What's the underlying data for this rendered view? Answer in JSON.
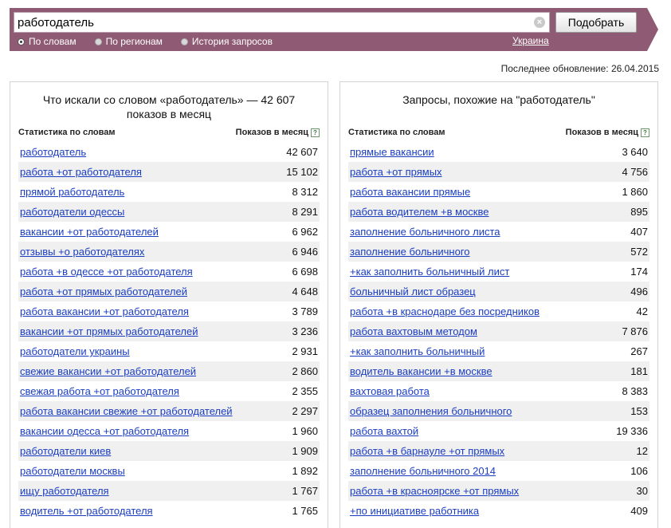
{
  "search": {
    "query": "работодатель",
    "submit_label": "Подобрать",
    "clear_glyph": "×"
  },
  "modes": [
    {
      "label": "По словам",
      "selected": true
    },
    {
      "label": "По регионам",
      "selected": false
    },
    {
      "label": "История запросов",
      "selected": false
    }
  ],
  "region": "Украина",
  "last_update": "Последнее обновление: 26.04.2015",
  "left_panel": {
    "title": "Что искали со словом «работодатель» — 42 607 показов в месяц",
    "col_phrase": "Статистика по словам",
    "col_count": "Показов в месяц",
    "help_glyph": "?",
    "rows": [
      {
        "phrase": "работодатель",
        "count": "42 607"
      },
      {
        "phrase": "работа +от работодателя",
        "count": "15 102"
      },
      {
        "phrase": "прямой работодатель",
        "count": "8 312"
      },
      {
        "phrase": "работодатели одессы",
        "count": "8 291"
      },
      {
        "phrase": "вакансии +от работодателей",
        "count": "6 962"
      },
      {
        "phrase": "отзывы +о работодателях",
        "count": "6 946"
      },
      {
        "phrase": "работа +в одессе +от работодателя",
        "count": "6 698"
      },
      {
        "phrase": "работа +от прямых работодателей",
        "count": "4 648"
      },
      {
        "phrase": "работа вакансии +от работодателя",
        "count": "3 789"
      },
      {
        "phrase": "вакансии +от прямых работодателей",
        "count": "3 236"
      },
      {
        "phrase": "работодатели украины",
        "count": "2 931"
      },
      {
        "phrase": "свежие вакансии +от работодателей",
        "count": "2 860"
      },
      {
        "phrase": "свежая работа +от работодателя",
        "count": "2 355"
      },
      {
        "phrase": "работа вакансии свежие +от работодателей",
        "count": "2 297"
      },
      {
        "phrase": "вакансии одесса +от работодателя",
        "count": "1 960"
      },
      {
        "phrase": "работодатели киев",
        "count": "1 909"
      },
      {
        "phrase": "работодатели москвы",
        "count": "1 892"
      },
      {
        "phrase": "ищу работодателя",
        "count": "1 767"
      },
      {
        "phrase": "водитель +от работодателя",
        "count": "1 765"
      }
    ]
  },
  "right_panel": {
    "title": "Запросы, похожие на \"работодатель\"",
    "col_phrase": "Статистика по словам",
    "col_count": "Показов в месяц",
    "help_glyph": "?",
    "rows": [
      {
        "phrase": "прямые вакансии",
        "count": "3 640"
      },
      {
        "phrase": "работа +от прямых",
        "count": "4 756"
      },
      {
        "phrase": "работа вакансии прямые",
        "count": "1 860"
      },
      {
        "phrase": "работа водителем +в москве",
        "count": "895"
      },
      {
        "phrase": "заполнение больничного листа",
        "count": "407"
      },
      {
        "phrase": "заполнение больничного",
        "count": "572"
      },
      {
        "phrase": "+как заполнить больничный лист",
        "count": "174"
      },
      {
        "phrase": "больничный лист образец",
        "count": "496"
      },
      {
        "phrase": "работа +в краснодаре без посредников",
        "count": "42"
      },
      {
        "phrase": "работа вахтовым методом",
        "count": "7 876"
      },
      {
        "phrase": "+как заполнить больничный",
        "count": "267"
      },
      {
        "phrase": "водитель вакансии +в москве",
        "count": "181"
      },
      {
        "phrase": "вахтовая работа",
        "count": "8 383"
      },
      {
        "phrase": "образец заполнения больничного",
        "count": "153"
      },
      {
        "phrase": "работа вахтой",
        "count": "19 336"
      },
      {
        "phrase": "работа +в барнауле +от прямых",
        "count": "12"
      },
      {
        "phrase": "заполнение больничного 2014",
        "count": "106"
      },
      {
        "phrase": "работа +в красноярске +от прямых",
        "count": "30"
      },
      {
        "phrase": "+по инициативе работника",
        "count": "409"
      }
    ]
  }
}
